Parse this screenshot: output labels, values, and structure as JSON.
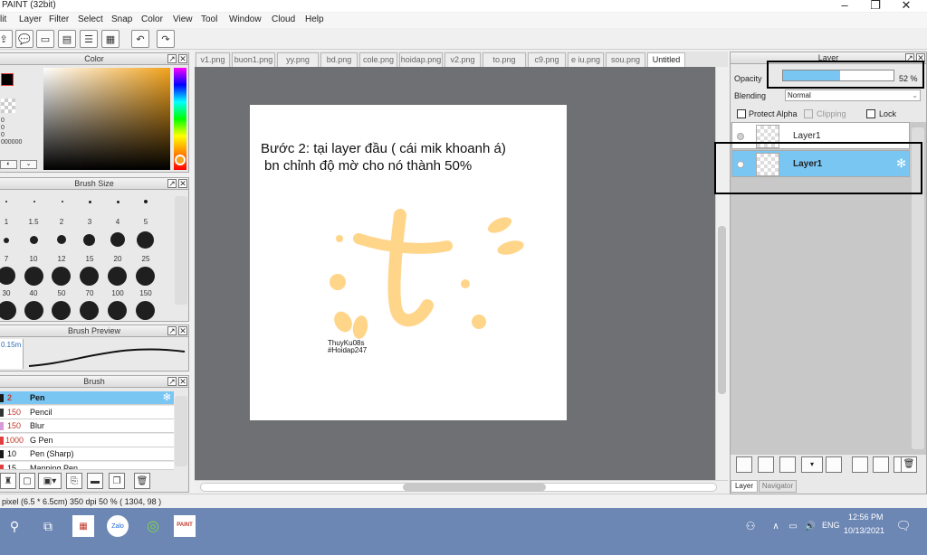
{
  "app": {
    "title": "PAINT (32bit)"
  },
  "window_controls": {
    "minimize": "–",
    "maximize": "❐",
    "close": "✕"
  },
  "menu": [
    "lit",
    "Layer",
    "Filter",
    "Select",
    "Snap",
    "Color",
    "View",
    "Tool",
    "Window",
    "Cloud",
    "Help"
  ],
  "toolbar": {
    "icons": [
      "export-icon",
      "speech-bubble-icon",
      "message-icon",
      "document-icon",
      "list-icon",
      "chart-icon",
      "undo-icon",
      "redo-icon"
    ]
  },
  "color_panel": {
    "title": "Color",
    "primary_color": "#000000",
    "secondary_color": "#ffffff",
    "values": [
      "0",
      "0",
      "0",
      "000000"
    ]
  },
  "brush_size_panel": {
    "title": "Brush Size",
    "rows": [
      [
        "1",
        "1.5",
        "2",
        "3",
        "4",
        "5"
      ],
      [
        "7",
        "10",
        "12",
        "15",
        "20",
        "25"
      ],
      [
        "30",
        "40",
        "50",
        "70",
        "100",
        "150"
      ]
    ]
  },
  "brush_preview_panel": {
    "title": "Brush Preview",
    "size": "0.15m"
  },
  "brush_panel": {
    "title": "Brush",
    "items": [
      {
        "size": "2",
        "name": "Pen",
        "color": "#1a1a1a",
        "selected": true
      },
      {
        "size": "150",
        "name": "Pencil",
        "color": "#333333"
      },
      {
        "size": "150",
        "name": "Blur",
        "color": "#d99ad9"
      },
      {
        "size": "1000",
        "name": "G Pen",
        "color": "#e04040"
      },
      {
        "size": "10",
        "name": "Pen (Sharp)",
        "color": "#1a1a1a"
      },
      {
        "size": "15",
        "name": "Mapping Pen",
        "color": "#e04040"
      }
    ]
  },
  "tabs": [
    {
      "label": "v1.png"
    },
    {
      "label": "buon1.png"
    },
    {
      "label": "yy.png"
    },
    {
      "label": "bd.png"
    },
    {
      "label": "cole.png"
    },
    {
      "label": "hoidap.png"
    },
    {
      "label": "v2.png"
    },
    {
      "label": "to.png"
    },
    {
      "label": "c9.png"
    },
    {
      "label": "e iu.png"
    },
    {
      "label": "sou.png"
    },
    {
      "label": "Untitled",
      "active": true
    }
  ],
  "canvas": {
    "line1": "Bước 2: tại layer đầu ( cái mik khoanh á)",
    "line2": "bn chỉnh độ mờ cho nó thành 50%",
    "watermark1": "ThuyKu08s",
    "watermark2": "#Hoidap247",
    "art_color": "#ffd58a"
  },
  "status": {
    "text": "pixel  (6.5 * 6.5cm)  350 dpi  50 %  ( 1304, 98 )"
  },
  "layer_panel": {
    "title": "Layer",
    "opacity_label": "Opacity",
    "opacity_value": "52 %",
    "opacity_fraction": 0.52,
    "blending_label": "Blending",
    "blending_value": "Normal",
    "protect_alpha": "Protect Alpha",
    "clipping": "Clipping",
    "lock": "Lock",
    "layers": [
      {
        "name": "Layer1",
        "selected": false
      },
      {
        "name": "Layer1",
        "selected": true
      }
    ],
    "tab_layer": "Layer",
    "tab_navigator": "Navigator"
  },
  "taskbar": {
    "time": "12:56 PM",
    "date": "10/13/2021",
    "lang": "ENG",
    "zalo_label": "Zalo",
    "paint_label": "PAINT"
  },
  "colors": {
    "accent": "#7ac6f2",
    "canvas_bg": "#6e7074",
    "taskbar": "#6d87b5",
    "highlight_box": "#000000"
  }
}
